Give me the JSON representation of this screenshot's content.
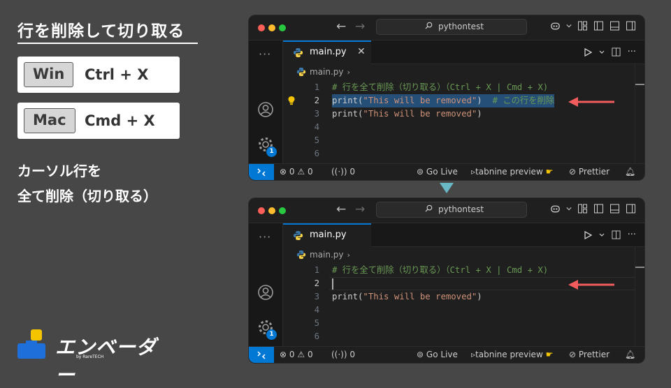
{
  "slide": {
    "title": "行を削除して切り取る",
    "shortcuts": [
      {
        "os": "Win",
        "keys": "Ctrl + X"
      },
      {
        "os": "Mac",
        "keys": "Cmd + X"
      }
    ],
    "description": [
      "カーソル行を",
      "全て削除（切り取る）"
    ],
    "logo": {
      "text": "エンベーダー",
      "sub": "by RareTECH"
    }
  },
  "editor": {
    "search_text": "pythontest",
    "tab_label": "main.py",
    "tab_close": "✕",
    "breadcrumb_file": "main.py",
    "breadcrumb_sep": "›",
    "dots": "···",
    "gear_badge": "1",
    "status": {
      "errors": "0",
      "warnings": "0",
      "ports": "0",
      "golive": "Go Live",
      "tabnine": "tabnine preview",
      "prettier": "Prettier"
    }
  },
  "before": {
    "lines": [
      {
        "n": "1",
        "comment": "# 行を全て削除（切り取る）（Ctrl + X | Cmd + X)"
      },
      {
        "n": "2",
        "fn": "print(",
        "str": "\"This will be removed\"",
        "close": ")",
        "comment": "  # この行を削除"
      },
      {
        "n": "3",
        "fn": "print(",
        "str": "\"This will be removed\"",
        "close": ")"
      },
      {
        "n": "4"
      },
      {
        "n": "5"
      },
      {
        "n": "6"
      }
    ]
  },
  "after": {
    "lines": [
      {
        "n": "1",
        "comment": "# 行を全て削除（切り取る）（Ctrl + X | Cmd + X)"
      },
      {
        "n": "2"
      },
      {
        "n": "3",
        "fn": "print(",
        "str": "\"This will be removed\"",
        "close": ")"
      },
      {
        "n": "4"
      },
      {
        "n": "5"
      },
      {
        "n": "6"
      }
    ]
  },
  "colors": {
    "accent": "#0078d4",
    "arrow": "#f25c5c",
    "down_arrow": "#6ab7c6",
    "comment": "#6a9955",
    "string": "#ce9178",
    "selection": "#264f78"
  }
}
